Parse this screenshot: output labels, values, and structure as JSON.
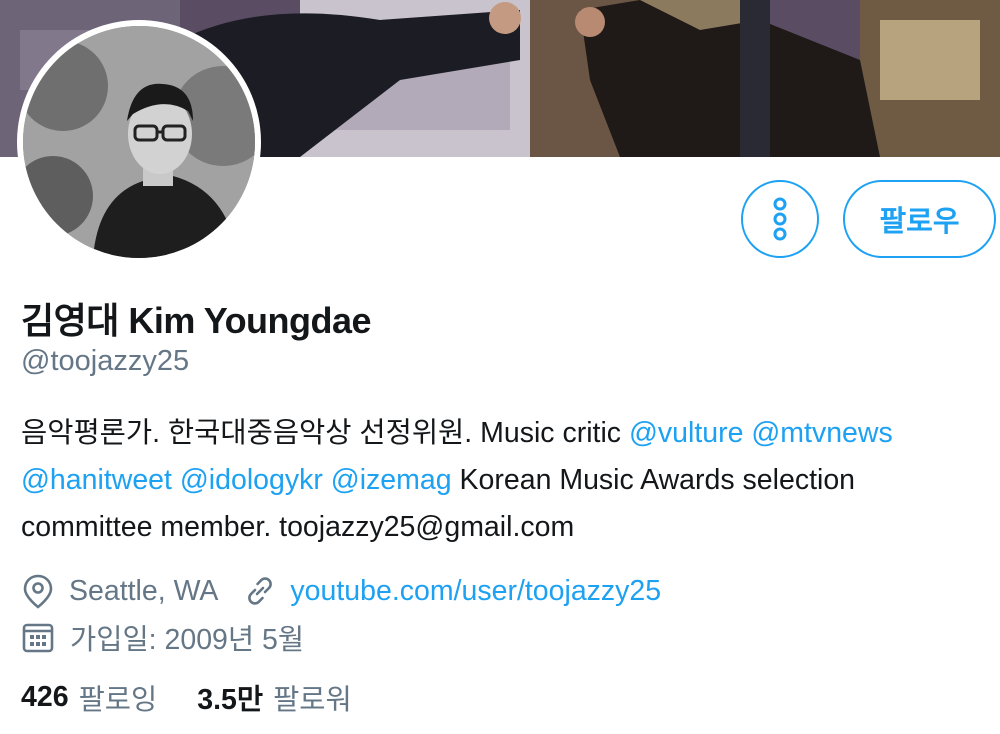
{
  "profile": {
    "name": "김영대 Kim Youngdae",
    "handle": "@toojazzy25",
    "follow_label": "팔로우"
  },
  "bio": {
    "line1_text": "음악평론가. 한국대중음악상 선정위원. Music critic ",
    "line1_mention1": "@vulture",
    "line1_mention2": "@mtvnews",
    "line2_mention1": "@hanitweet",
    "line2_mention2": "@idologykr",
    "line2_mention3": "@izemag",
    "line2_text": " Korean Music Awards selection",
    "line3_text": "committee member. toojazzy25@gmail.com"
  },
  "meta": {
    "location": "Seattle, WA",
    "website": "youtube.com/user/toojazzy25",
    "joined": "가입일: 2009년 5월"
  },
  "stats": {
    "following_count": "426",
    "following_label": "팔로잉",
    "followers_count": "3.5만",
    "followers_label": "팔로워"
  },
  "icons": {
    "more": "more-vertical-icon",
    "location": "location-pin-icon",
    "link": "link-icon",
    "calendar": "calendar-icon"
  },
  "colors": {
    "accent": "#1da1f2",
    "text": "#14171a",
    "secondary": "#657786"
  }
}
